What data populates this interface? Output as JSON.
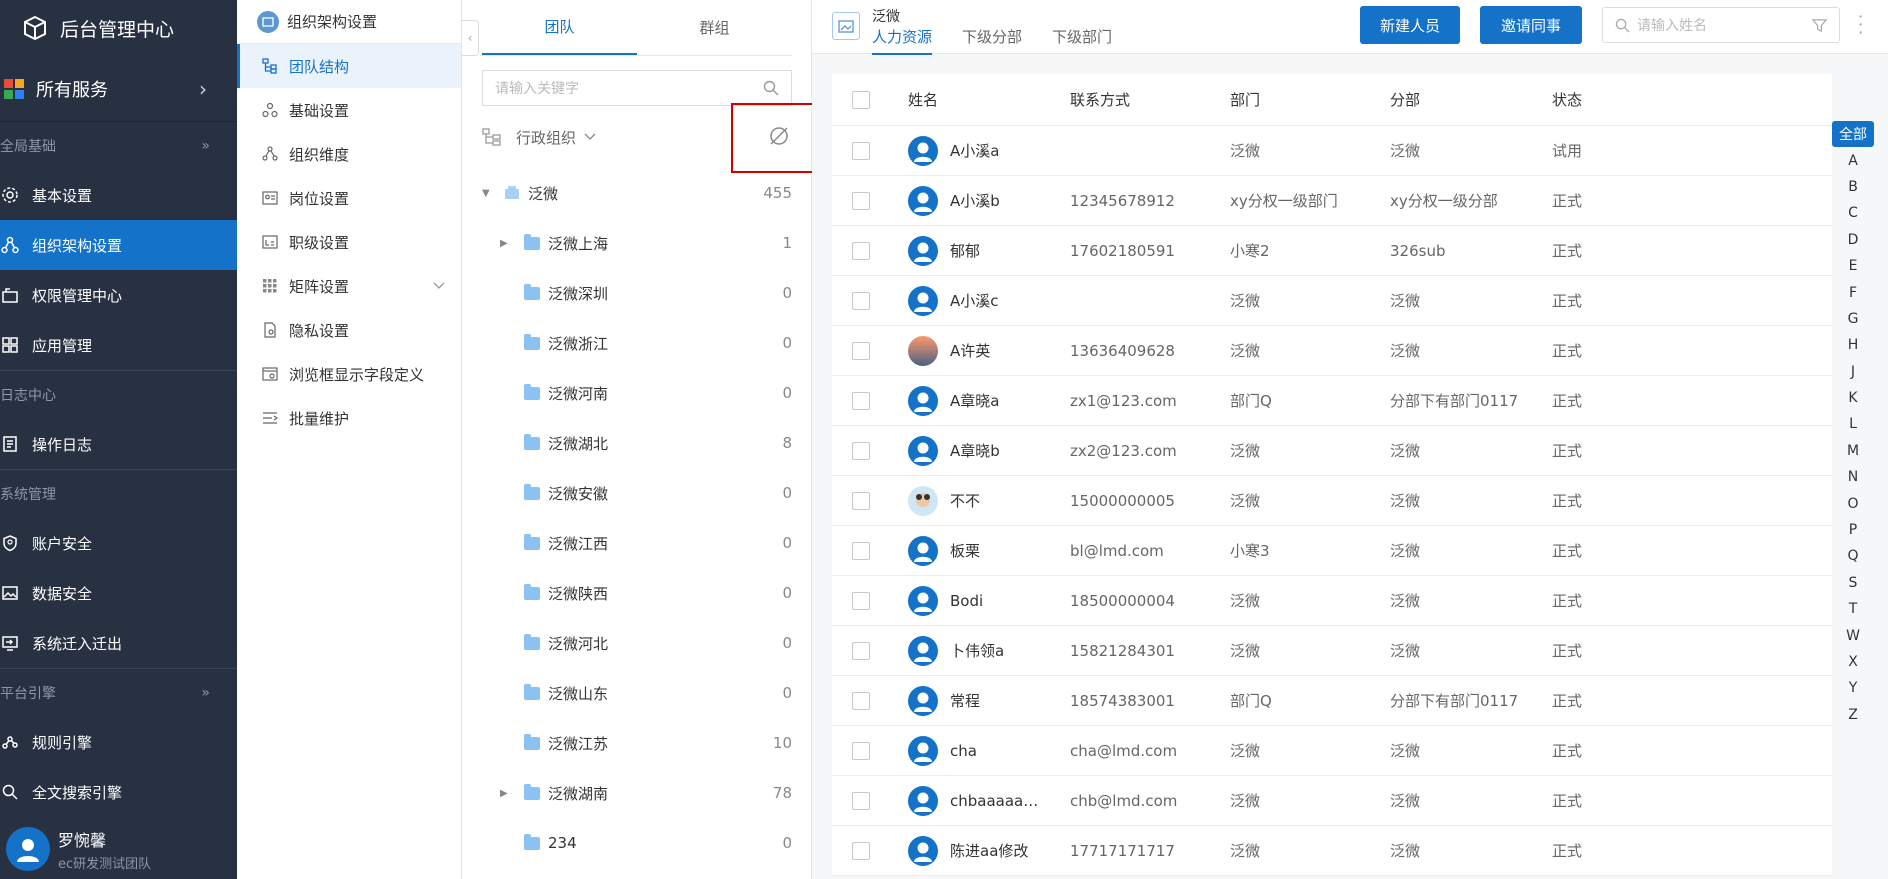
{
  "sidebar": {
    "title": "后台管理中心",
    "all_services": "所有服务",
    "groups": [
      {
        "label": "全局基础"
      },
      {
        "label": "日志中心"
      },
      {
        "label": "系统管理"
      },
      {
        "label": "平台引擎"
      }
    ],
    "items": [
      {
        "label": "基本设置",
        "icon": "gear-icon"
      },
      {
        "label": "组织架构设置",
        "icon": "org-icon"
      },
      {
        "label": "权限管理中心",
        "icon": "permission-icon"
      },
      {
        "label": "应用管理",
        "icon": "apps-icon"
      },
      {
        "label": "操作日志",
        "icon": "log-icon"
      },
      {
        "label": "账户安全",
        "icon": "shield-icon"
      },
      {
        "label": "数据安全",
        "icon": "image-icon"
      },
      {
        "label": "系统迁入迁出",
        "icon": "migrate-icon"
      },
      {
        "label": "规则引擎",
        "icon": "rule-icon"
      },
      {
        "label": "全文搜索引擎",
        "icon": "search-icon"
      }
    ],
    "user": {
      "name": "罗惋馨",
      "team": "ec研发测试团队"
    },
    "accent": "#1572c9",
    "bg": "#283142"
  },
  "menu2": {
    "header": "组织架构设置",
    "items": [
      {
        "label": "团队结构"
      },
      {
        "label": "基础设置"
      },
      {
        "label": "组织维度"
      },
      {
        "label": "岗位设置"
      },
      {
        "label": "职级设置"
      },
      {
        "label": "矩阵设置"
      },
      {
        "label": "隐私设置"
      },
      {
        "label": "浏览框显示字段定义"
      },
      {
        "label": "批量维护"
      }
    ]
  },
  "tree": {
    "tabs": [
      "团队",
      "群组"
    ],
    "search_placeholder": "请输入关键字",
    "org_type": "行政组织",
    "nodes": [
      {
        "name": "泛微",
        "count": "455"
      },
      {
        "name": "泛微上海",
        "count": "1"
      },
      {
        "name": "泛微深圳",
        "count": "0"
      },
      {
        "name": "泛微浙江",
        "count": "0"
      },
      {
        "name": "泛微河南",
        "count": "0"
      },
      {
        "name": "泛微湖北",
        "count": "8"
      },
      {
        "name": "泛微安徽",
        "count": "0"
      },
      {
        "name": "泛微江西",
        "count": "0"
      },
      {
        "name": "泛微陕西",
        "count": "0"
      },
      {
        "name": "泛微河北",
        "count": "0"
      },
      {
        "name": "泛微山东",
        "count": "0"
      },
      {
        "name": "泛微江苏",
        "count": "10"
      },
      {
        "name": "泛微湖南",
        "count": "78"
      },
      {
        "name": "234",
        "count": "0"
      }
    ]
  },
  "main": {
    "company": "泛微",
    "subtabs": [
      "人力资源",
      "下级分部",
      "下级部门"
    ],
    "new_button": "新建人员",
    "invite_button": "邀请同事",
    "name_search_placeholder": "请输入姓名",
    "columns": [
      "姓名",
      "联系方式",
      "部门",
      "分部",
      "状态"
    ],
    "rows": [
      {
        "name": "A小溪a",
        "contact": "",
        "dept": "泛微",
        "branch": "泛微",
        "status": "试用"
      },
      {
        "name": "A小溪b",
        "contact": "12345678912",
        "dept": "xy分权一级部门",
        "branch": "xy分权一级分部",
        "status": "正式"
      },
      {
        "name": "郁郁",
        "contact": "17602180591",
        "dept": "小寒2",
        "branch": "326sub",
        "status": "正式"
      },
      {
        "name": "A小溪c",
        "contact": "",
        "dept": "泛微",
        "branch": "泛微",
        "status": "正式"
      },
      {
        "name": "A许英",
        "contact": "13636409628",
        "dept": "泛微",
        "branch": "泛微",
        "status": "正式"
      },
      {
        "name": "A章晓a",
        "contact": "zx1@123.com",
        "dept": "部门Q",
        "branch": "分部下有部门0117",
        "status": "正式"
      },
      {
        "name": "A章晓b",
        "contact": "zx2@123.com",
        "dept": "泛微",
        "branch": "泛微",
        "status": "正式"
      },
      {
        "name": "不不",
        "contact": "15000000005",
        "dept": "泛微",
        "branch": "泛微",
        "status": "正式"
      },
      {
        "name": "板栗",
        "contact": "bl@lmd.com",
        "dept": "小寒3",
        "branch": "泛微",
        "status": "正式"
      },
      {
        "name": "Bodi",
        "contact": "18500000004",
        "dept": "泛微",
        "branch": "泛微",
        "status": "正式"
      },
      {
        "name": "卜伟领a",
        "contact": "15821284301",
        "dept": "泛微",
        "branch": "泛微",
        "status": "正式"
      },
      {
        "name": "常程",
        "contact": "18574383001",
        "dept": "部门Q",
        "branch": "分部下有部门0117",
        "status": "正式"
      },
      {
        "name": "cha",
        "contact": "cha@lmd.com",
        "dept": "泛微",
        "branch": "泛微",
        "status": "正式"
      },
      {
        "name": "chbaaaaa…",
        "contact": "chb@lmd.com",
        "dept": "泛微",
        "branch": "泛微",
        "status": "正式"
      },
      {
        "name": "陈进aa修改",
        "contact": "17717171717",
        "dept": "泛微",
        "branch": "泛微",
        "status": "正式"
      }
    ],
    "alphabet": [
      "全部",
      "A",
      "B",
      "C",
      "D",
      "E",
      "F",
      "G",
      "H",
      "J",
      "K",
      "L",
      "M",
      "N",
      "O",
      "P",
      "Q",
      "S",
      "T",
      "W",
      "X",
      "Y",
      "Z"
    ]
  }
}
